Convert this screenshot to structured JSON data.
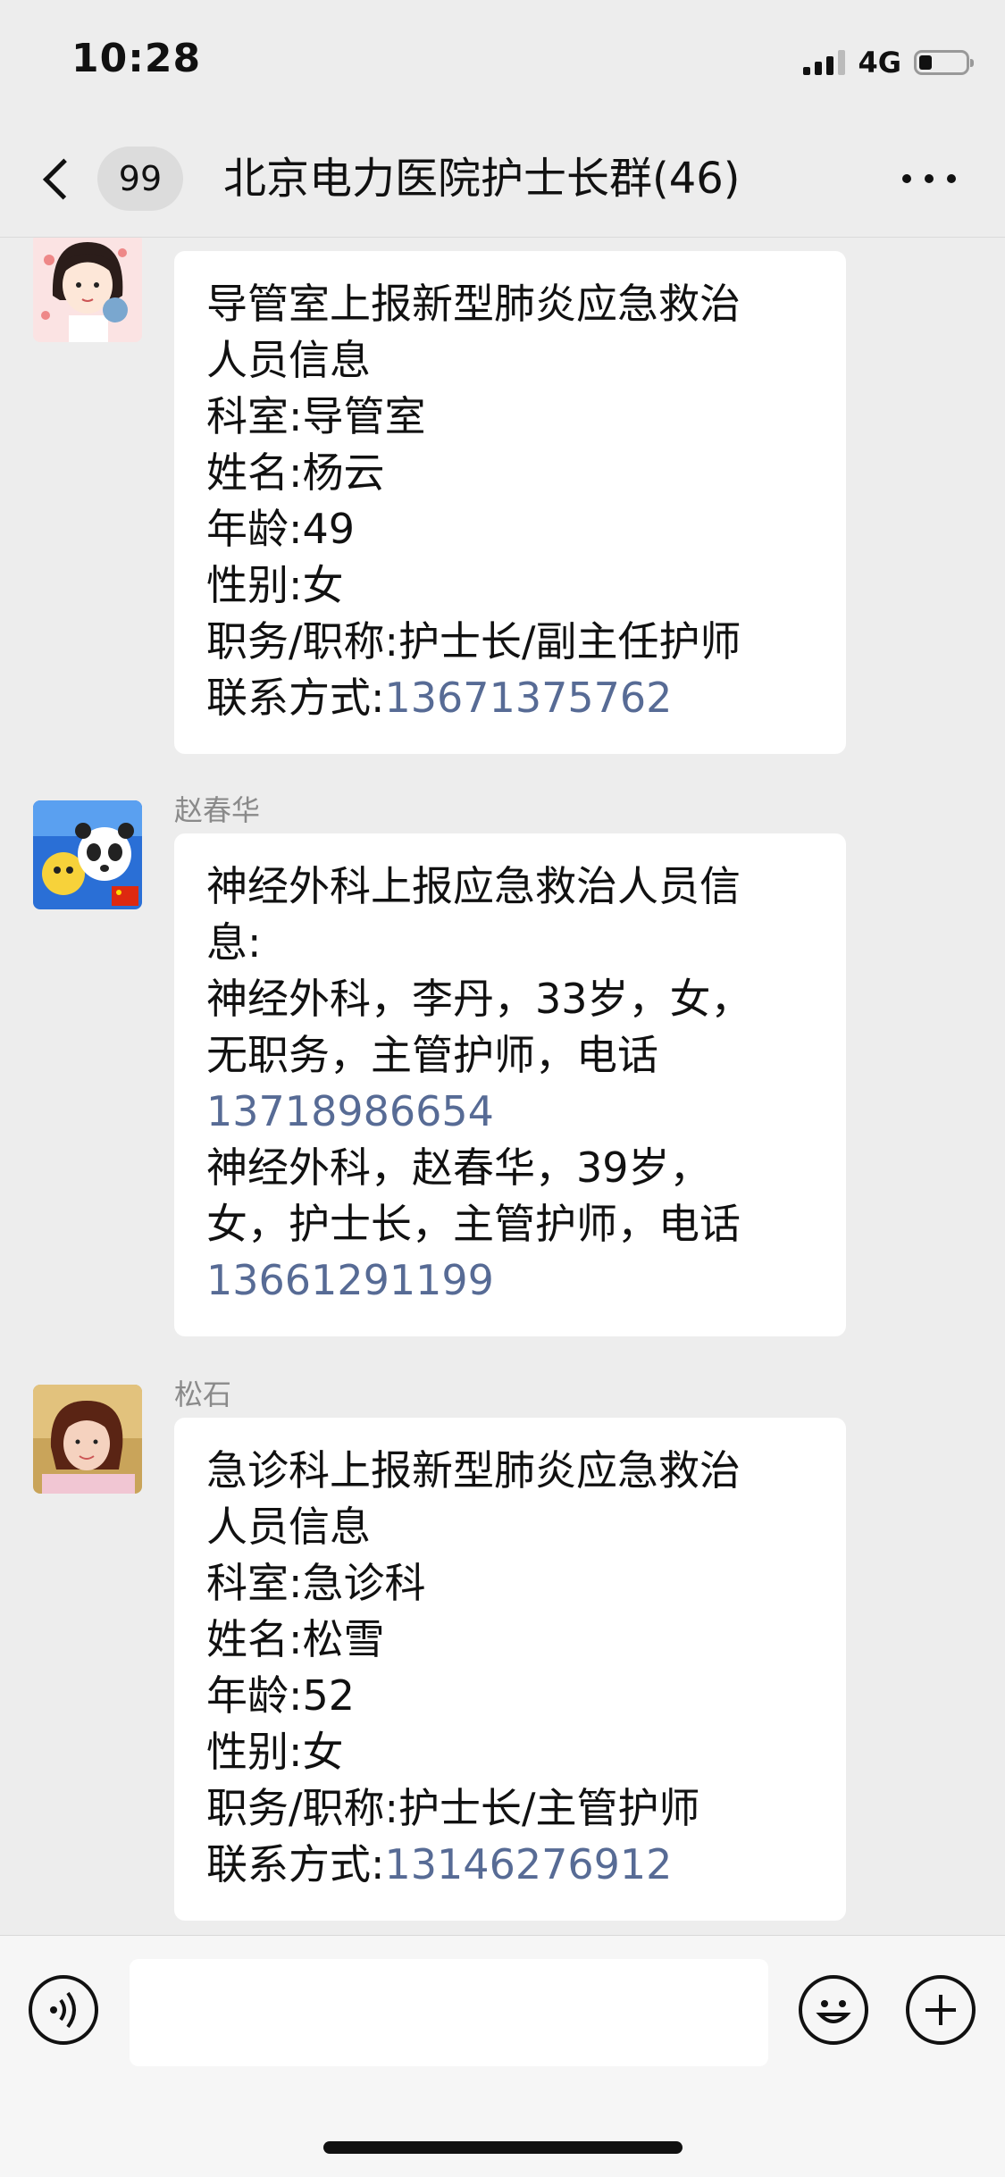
{
  "status_bar": {
    "time": "10:28",
    "network": "4G"
  },
  "nav": {
    "unread_count": "99",
    "title": "北京电力医院护士长群(46)"
  },
  "messages": [
    {
      "sender": "",
      "lines": [
        "导管室上报新型肺炎应急救治",
        "人员信息",
        "科室:导管室",
        "姓名:杨云",
        "年龄:49",
        "性别:女",
        "职务/职称:护士长/副主任护师"
      ],
      "contact_prefix": "联系方式:",
      "contact_phone": "13671375762"
    },
    {
      "sender": "赵春华",
      "lines": [
        "神经外科上报应急救治人员信",
        "息:",
        "神经外科，李丹，33岁，女，",
        "无职务，主管护师，电话"
      ],
      "phone_1": "13718986654",
      "lines_2": [
        "神经外科，赵春华，39岁，",
        "女，护士长，主管护师，电话"
      ],
      "phone_2": "13661291199"
    },
    {
      "sender": "松石",
      "lines": [
        "急诊科上报新型肺炎应急救治",
        "人员信息",
        "科室:急诊科",
        "姓名:松雪",
        "年龄:52",
        "性别:女",
        "职务/职称:护士长/主管护师"
      ],
      "contact_prefix": "联系方式:",
      "contact_phone": "13146276912"
    }
  ],
  "input_bar": {
    "placeholder": ""
  },
  "colors": {
    "background": "#ededed",
    "bubble": "#ffffff",
    "link": "#576b95"
  }
}
